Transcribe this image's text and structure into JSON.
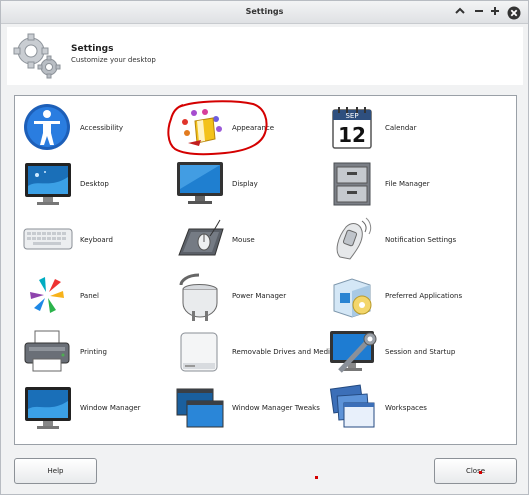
{
  "window": {
    "title": "Settings",
    "controls": [
      "minimize",
      "maximize",
      "close"
    ]
  },
  "header": {
    "title": "Settings",
    "subtitle": "Customize your desktop"
  },
  "items": [
    {
      "label": "Accessibility",
      "icon": "accessibility-icon"
    },
    {
      "label": "Appearance",
      "icon": "appearance-icon"
    },
    {
      "label": "Calendar",
      "icon": "calendar-icon",
      "month": "SEP",
      "day": "12"
    },
    {
      "label": "Desktop",
      "icon": "desktop-icon"
    },
    {
      "label": "Display",
      "icon": "display-icon"
    },
    {
      "label": "File Manager",
      "icon": "file-manager-icon"
    },
    {
      "label": "Keyboard",
      "icon": "keyboard-icon"
    },
    {
      "label": "Mouse",
      "icon": "mouse-icon"
    },
    {
      "label": "Notification Settings",
      "icon": "notification-icon"
    },
    {
      "label": "Panel",
      "icon": "panel-icon"
    },
    {
      "label": "Power Manager",
      "icon": "power-plug-icon"
    },
    {
      "label": "Preferred Applications",
      "icon": "preferred-apps-icon"
    },
    {
      "label": "Printing",
      "icon": "printer-icon"
    },
    {
      "label": "Removable Drives and Media",
      "icon": "removable-drive-icon"
    },
    {
      "label": "Session and Startup",
      "icon": "session-startup-icon"
    },
    {
      "label": "Window Manager",
      "icon": "window-manager-icon"
    },
    {
      "label": "Window Manager Tweaks",
      "icon": "window-tweaks-icon"
    },
    {
      "label": "Workspaces",
      "icon": "workspaces-icon"
    }
  ],
  "buttons": {
    "help": "Help",
    "close": "Close"
  },
  "colors": {
    "annotation": "#d40000",
    "accent": "#1a73c8"
  }
}
